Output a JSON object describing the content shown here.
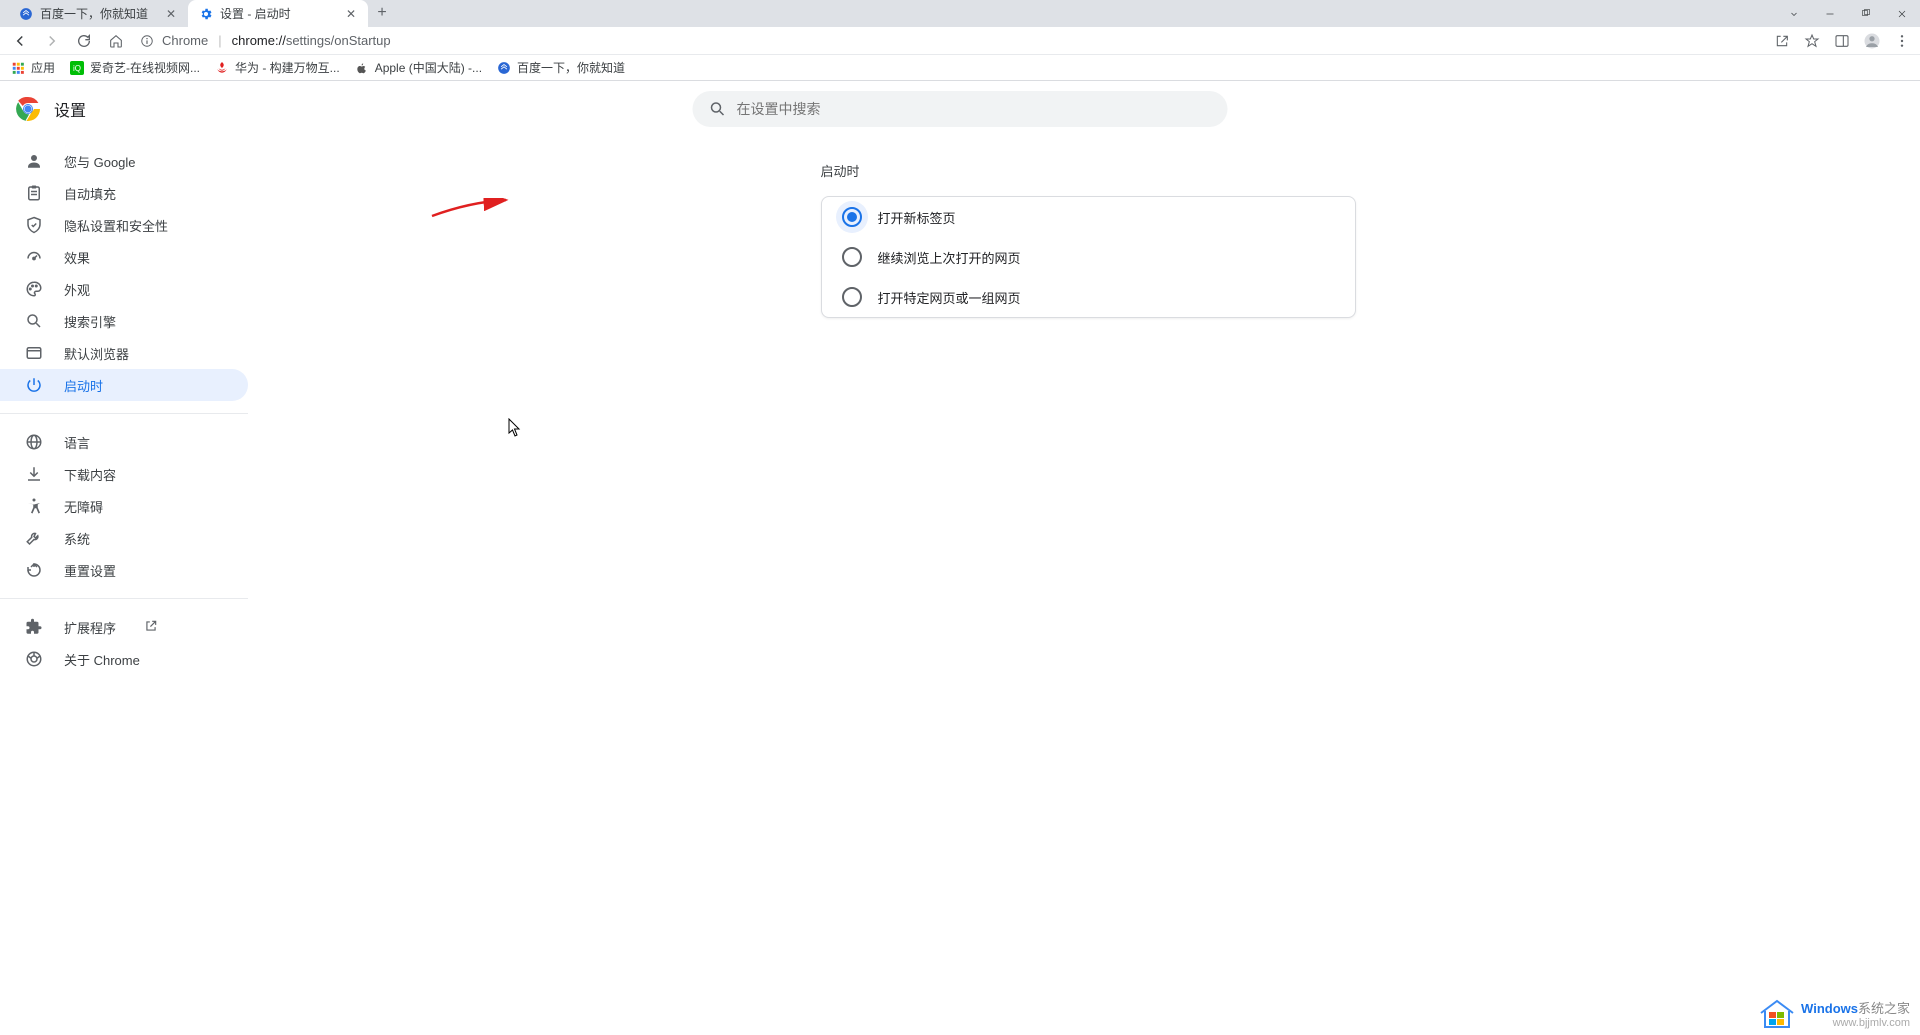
{
  "tabs": [
    {
      "title": "百度一下，你就知道",
      "favicon_color": "#2a67d4"
    },
    {
      "title": "设置 - 启动时",
      "favicon_color": "#1a73e8"
    }
  ],
  "addressbar": {
    "prefix": "Chrome",
    "url_scheme": "chrome://",
    "url_path": "settings/onStartup"
  },
  "bookmarks": {
    "apps_label": "应用",
    "items": [
      {
        "label": "爱奇艺-在线视频网...",
        "color": "#00be06"
      },
      {
        "label": "华为 - 构建万物互...",
        "color": "#e02020"
      },
      {
        "label": "Apple (中国大陆) -...",
        "color": "#555"
      },
      {
        "label": "百度一下，你就知道",
        "color": "#2a67d4"
      }
    ]
  },
  "settings": {
    "title": "设置",
    "search_placeholder": "在设置中搜索",
    "nav": [
      {
        "id": "you-and-google",
        "label": "您与 Google",
        "icon": "person"
      },
      {
        "id": "autofill",
        "label": "自动填充",
        "icon": "assignment"
      },
      {
        "id": "privacy",
        "label": "隐私设置和安全性",
        "icon": "shield"
      },
      {
        "id": "performance",
        "label": "效果",
        "icon": "speed"
      },
      {
        "id": "appearance",
        "label": "外观",
        "icon": "palette"
      },
      {
        "id": "search-engine",
        "label": "搜索引擎",
        "icon": "search"
      },
      {
        "id": "default-browser",
        "label": "默认浏览器",
        "icon": "browser"
      },
      {
        "id": "on-startup",
        "label": "启动时",
        "icon": "power",
        "active": true
      }
    ],
    "nav2": [
      {
        "id": "languages",
        "label": "语言",
        "icon": "globe"
      },
      {
        "id": "downloads",
        "label": "下载内容",
        "icon": "download"
      },
      {
        "id": "accessibility",
        "label": "无障碍",
        "icon": "accessibility"
      },
      {
        "id": "system",
        "label": "系统",
        "icon": "wrench"
      },
      {
        "id": "reset",
        "label": "重置设置",
        "icon": "restore"
      }
    ],
    "nav3": [
      {
        "id": "extensions",
        "label": "扩展程序",
        "icon": "extension",
        "external": true
      },
      {
        "id": "about",
        "label": "关于 Chrome",
        "icon": "chrome"
      }
    ],
    "section_title": "启动时",
    "options": [
      {
        "id": "newtab",
        "label": "打开新标签页",
        "selected": true
      },
      {
        "id": "continue",
        "label": "继续浏览上次打开的网页",
        "selected": false
      },
      {
        "id": "specific",
        "label": "打开特定网页或一组网页",
        "selected": false
      }
    ]
  },
  "watermark": {
    "brand1": "Windows",
    "brand2": "系统之家",
    "url": "www.bjjmlv.com"
  }
}
